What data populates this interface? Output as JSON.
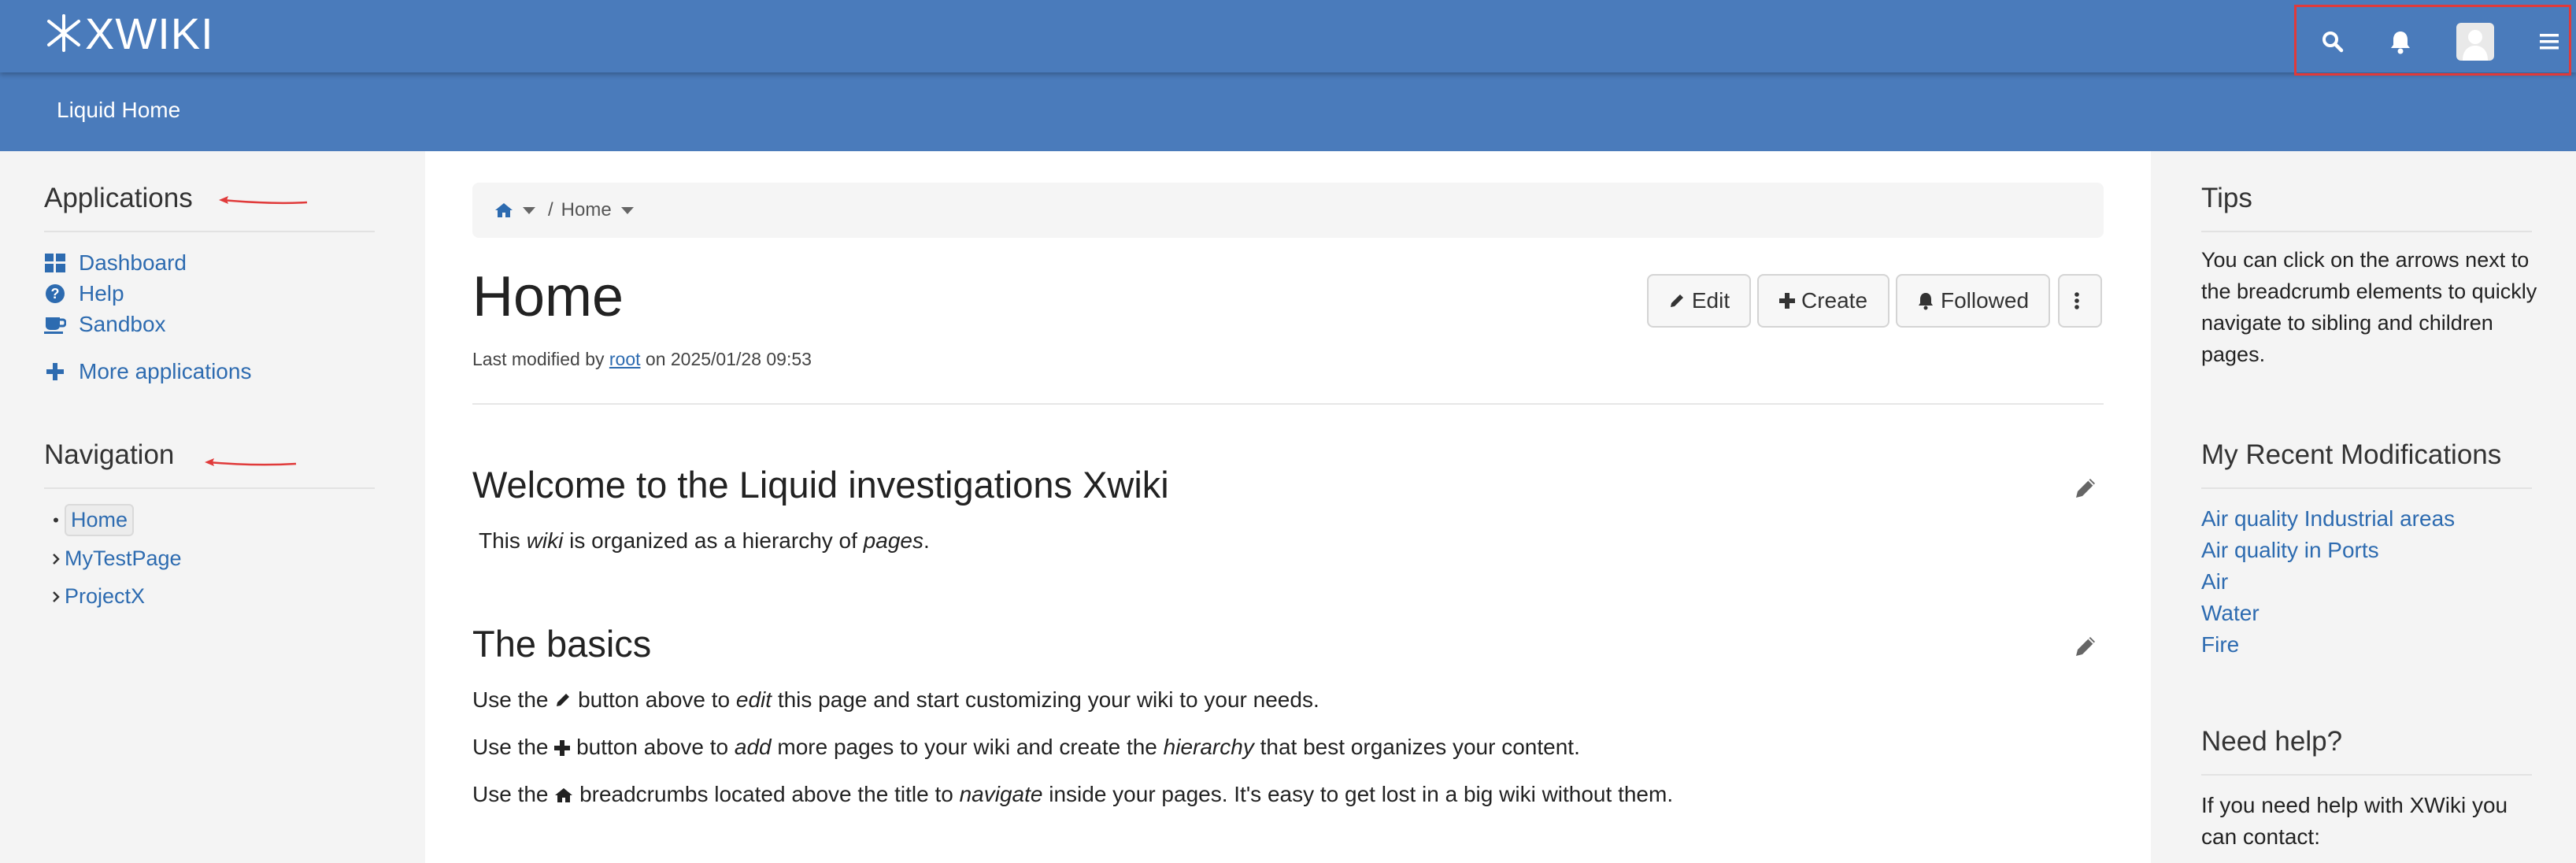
{
  "header": {
    "logo_text": "XWIKI",
    "subbar_title": "Liquid Home",
    "icons": [
      "search-icon",
      "bell-icon",
      "user-avatar",
      "menu-icon"
    ],
    "accent_color": "#4a7bbb"
  },
  "left_panel": {
    "applications_title": "Applications",
    "applications": [
      {
        "label": "Dashboard",
        "icon": "dashboard-icon"
      },
      {
        "label": "Help",
        "icon": "question-circle-icon"
      },
      {
        "label": "Sandbox",
        "icon": "coffee-cup-icon"
      }
    ],
    "more_applications": "More applications",
    "navigation_title": "Navigation",
    "navigation": [
      {
        "label": "Home",
        "marker": "bullet"
      },
      {
        "label": "MyTestPage",
        "marker": "chevron"
      },
      {
        "label": "ProjectX",
        "marker": "chevron"
      }
    ]
  },
  "breadcrumb": {
    "separator": "/",
    "current": "Home"
  },
  "page": {
    "title": "Home",
    "meta_prefix": "Last modified by",
    "meta_author": "root",
    "meta_suffix": "on 2025/01/28 09:53",
    "buttons": {
      "edit": "Edit",
      "create": "Create",
      "followed": "Followed"
    },
    "welcome_heading": "Welcome to the Liquid investigations Xwiki",
    "welcome_text": {
      "p1": "This",
      "p2": "wiki",
      "p3": "is organized as a hierarchy of",
      "p4": "pages",
      "p5": "."
    },
    "basics_heading": "The basics",
    "basics": [
      {
        "a": "Use the",
        "b": "button above to",
        "c": "edit",
        "d": "this page and start customizing your wiki to your needs."
      },
      {
        "a": "Use the",
        "b": "button above to",
        "c": "add",
        "d": "more pages to your wiki and create the",
        "e": "hierarchy",
        "f": "that best organizes your content."
      },
      {
        "a": "Use the",
        "b": "breadcrumbs located above the title to",
        "c": "navigate",
        "d": "inside your pages. It's easy to get lost in a big wiki without them."
      }
    ]
  },
  "right_panel": {
    "tips_title": "Tips",
    "tips_text": "You can click on the arrows next to the breadcrumb elements to quickly navigate to sibling and children pages.",
    "recent_title": "My Recent Modifications",
    "recent": [
      "Air quality Industrial areas",
      "Air quality in Ports",
      "Air",
      "Water",
      "Fire"
    ],
    "help_title": "Need help?",
    "help_text": "If you need help with XWiki you can contact:"
  }
}
